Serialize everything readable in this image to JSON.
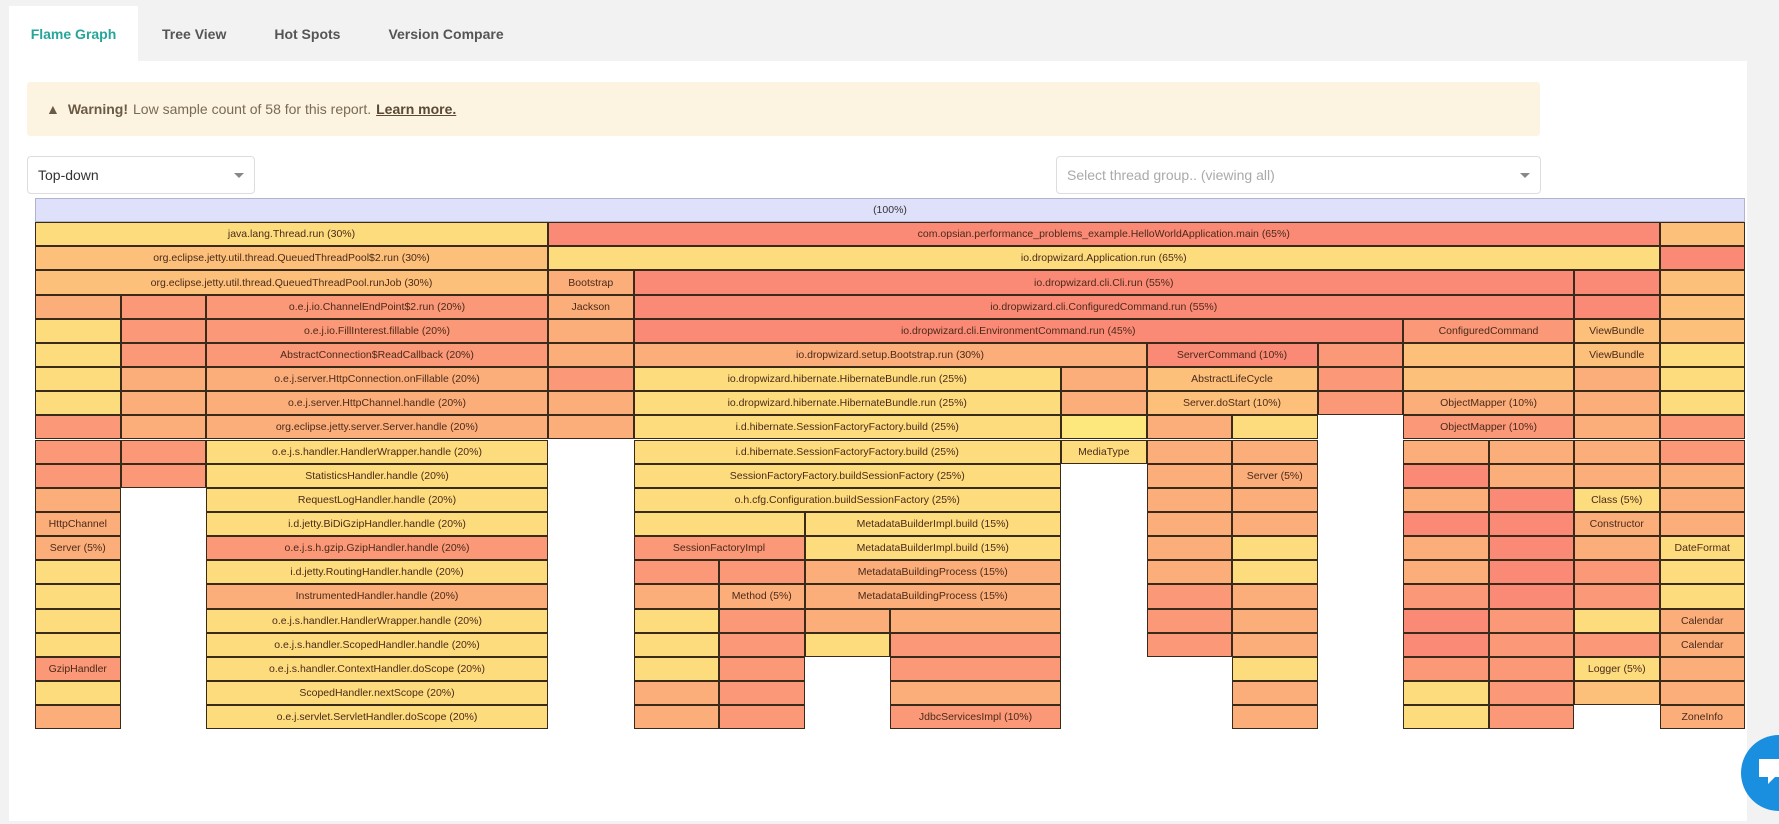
{
  "tabs": [
    {
      "label": "Flame Graph",
      "active": true
    },
    {
      "label": "Tree View",
      "active": false
    },
    {
      "label": "Hot Spots",
      "active": false
    },
    {
      "label": "Version Compare",
      "active": false
    }
  ],
  "warning": {
    "icon": "warning-triangle-icon",
    "title": "Warning!",
    "message": "Low sample count of 58 for this report.",
    "link": "Learn more."
  },
  "direction_select": {
    "value": "Top-down"
  },
  "thread_group_select": {
    "placeholder": "Select thread group.. (viewing all)"
  },
  "colors": {
    "root": "#dfe1fb",
    "yellow": "#fddc7e",
    "light_orange": "#fdc07a",
    "orange": "#fcae7a",
    "salmon": "#fa9878",
    "red": "#fa8a76",
    "bright_yellow": "#fde87e",
    "accent": "#26a69a",
    "chat": "#1a8fe0"
  },
  "flame_graph": {
    "total_units": 20,
    "rows": [
      [
        [
          0,
          20,
          "(100%)",
          "root"
        ]
      ],
      [
        [
          0,
          6,
          "java.lang.Thread.run (30%)",
          "yellow"
        ],
        [
          6,
          13,
          "com.opsian.performance_problems_example.HelloWorldApplication.main (65%)",
          "red"
        ],
        [
          19,
          1,
          "",
          "light_orange"
        ]
      ],
      [
        [
          0,
          6,
          "org.eclipse.jetty.util.thread.QueuedThreadPool$2.run (30%)",
          "light_orange"
        ],
        [
          6,
          13,
          "io.dropwizard.Application.run (65%)",
          "yellow"
        ],
        [
          19,
          1,
          "",
          "red"
        ]
      ],
      [
        [
          0,
          6,
          "org.eclipse.jetty.util.thread.QueuedThreadPool.runJob (30%)",
          "light_orange"
        ],
        [
          6,
          1,
          "Bootstrap",
          "orange"
        ],
        [
          7,
          11,
          "io.dropwizard.cli.Cli.run (55%)",
          "red"
        ],
        [
          18,
          1,
          "",
          "red"
        ],
        [
          19,
          1,
          "",
          "light_orange"
        ]
      ],
      [
        [
          0,
          1,
          "",
          "orange"
        ],
        [
          1,
          1,
          "",
          "salmon"
        ],
        [
          2,
          4,
          "o.e.j.io.ChannelEndPoint$2.run (20%)",
          "salmon"
        ],
        [
          6,
          1,
          "Jackson",
          "orange"
        ],
        [
          7,
          11,
          "io.dropwizard.cli.ConfiguredCommand.run (55%)",
          "red"
        ],
        [
          18,
          1,
          "",
          "red"
        ],
        [
          19,
          1,
          "",
          "light_orange"
        ]
      ],
      [
        [
          0,
          1,
          "",
          "yellow"
        ],
        [
          1,
          1,
          "",
          "salmon"
        ],
        [
          2,
          4,
          "o.e.j.io.FillInterest.fillable (20%)",
          "salmon"
        ],
        [
          6,
          1,
          "",
          "orange"
        ],
        [
          7,
          9,
          "io.dropwizard.cli.EnvironmentCommand.run (45%)",
          "red"
        ],
        [
          16,
          2,
          "ConfiguredCommand",
          "salmon"
        ],
        [
          18,
          1,
          "ViewBundle",
          "light_orange"
        ],
        [
          19,
          1,
          "",
          "light_orange"
        ]
      ],
      [
        [
          0,
          1,
          "",
          "yellow"
        ],
        [
          1,
          1,
          "",
          "salmon"
        ],
        [
          2,
          4,
          "AbstractConnection$ReadCallback (20%)",
          "salmon"
        ],
        [
          6,
          1,
          "",
          "orange"
        ],
        [
          7,
          6,
          "io.dropwizard.setup.Bootstrap.run (30%)",
          "orange"
        ],
        [
          13,
          2,
          "ServerCommand (10%)",
          "red"
        ],
        [
          15,
          1,
          "",
          "salmon"
        ],
        [
          16,
          2,
          "",
          "light_orange"
        ],
        [
          18,
          1,
          "ViewBundle",
          "light_orange"
        ],
        [
          19,
          1,
          "",
          "yellow"
        ]
      ],
      [
        [
          0,
          1,
          "",
          "yellow"
        ],
        [
          1,
          1,
          "",
          "orange"
        ],
        [
          2,
          4,
          "o.e.j.server.HttpConnection.onFillable (20%)",
          "orange"
        ],
        [
          6,
          1,
          "",
          "salmon"
        ],
        [
          7,
          5,
          "io.dropwizard.hibernate.HibernateBundle.run (25%)",
          "yellow"
        ],
        [
          12,
          1,
          "",
          "orange"
        ],
        [
          13,
          2,
          "AbstractLifeCycle",
          "light_orange"
        ],
        [
          15,
          1,
          "",
          "salmon"
        ],
        [
          16,
          2,
          "",
          "light_orange"
        ],
        [
          18,
          1,
          "",
          "orange"
        ],
        [
          19,
          1,
          "",
          "yellow"
        ]
      ],
      [
        [
          0,
          1,
          "",
          "yellow"
        ],
        [
          1,
          1,
          "",
          "orange"
        ],
        [
          2,
          4,
          "o.e.j.server.HttpChannel.handle (20%)",
          "orange"
        ],
        [
          6,
          1,
          "",
          "orange"
        ],
        [
          7,
          5,
          "io.dropwizard.hibernate.HibernateBundle.run (25%)",
          "yellow"
        ],
        [
          12,
          1,
          "",
          "orange"
        ],
        [
          13,
          2,
          "Server.doStart (10%)",
          "light_orange"
        ],
        [
          15,
          1,
          "",
          "salmon"
        ],
        [
          16,
          2,
          "ObjectMapper (10%)",
          "orange"
        ],
        [
          18,
          1,
          "",
          "orange"
        ],
        [
          19,
          1,
          "",
          "yellow"
        ]
      ],
      [
        [
          0,
          1,
          "",
          "salmon"
        ],
        [
          1,
          1,
          "",
          "orange"
        ],
        [
          2,
          4,
          "org.eclipse.jetty.server.Server.handle (20%)",
          "orange"
        ],
        [
          6,
          1,
          "",
          "orange"
        ],
        [
          7,
          5,
          "i.d.hibernate.SessionFactoryFactory.build (25%)",
          "yellow"
        ],
        [
          12,
          1,
          "",
          "bright_yellow"
        ],
        [
          13,
          1,
          "",
          "orange"
        ],
        [
          14,
          1,
          "",
          "yellow"
        ],
        [
          16,
          2,
          "ObjectMapper (10%)",
          "salmon"
        ],
        [
          18,
          1,
          "",
          "orange"
        ],
        [
          19,
          1,
          "",
          "salmon"
        ]
      ],
      [
        [
          0,
          1,
          "",
          "salmon"
        ],
        [
          1,
          1,
          "",
          "salmon"
        ],
        [
          2,
          4,
          "o.e.j.s.handler.HandlerWrapper.handle (20%)",
          "yellow"
        ],
        [
          7,
          5,
          "i.d.hibernate.SessionFactoryFactory.build (25%)",
          "yellow"
        ],
        [
          12,
          1,
          "MediaType",
          "yellow"
        ],
        [
          13,
          1,
          "",
          "orange"
        ],
        [
          14,
          1,
          "",
          "orange"
        ],
        [
          16,
          1,
          "",
          "orange"
        ],
        [
          17,
          1,
          "",
          "orange"
        ],
        [
          18,
          1,
          "",
          "orange"
        ],
        [
          19,
          1,
          "",
          "salmon"
        ]
      ],
      [
        [
          0,
          1,
          "",
          "salmon"
        ],
        [
          1,
          1,
          "",
          "salmon"
        ],
        [
          2,
          4,
          "StatisticsHandler.handle (20%)",
          "yellow"
        ],
        [
          7,
          5,
          "SessionFactoryFactory.buildSessionFactory (25%)",
          "yellow"
        ],
        [
          13,
          1,
          "",
          "orange"
        ],
        [
          14,
          1,
          "Server (5%)",
          "orange"
        ],
        [
          16,
          1,
          "",
          "red"
        ],
        [
          17,
          1,
          "",
          "orange"
        ],
        [
          18,
          1,
          "",
          "orange"
        ],
        [
          19,
          1,
          "",
          "orange"
        ]
      ],
      [
        [
          0,
          1,
          "",
          "orange"
        ],
        [
          2,
          4,
          "RequestLogHandler.handle (20%)",
          "yellow"
        ],
        [
          7,
          5,
          "o.h.cfg.Configuration.buildSessionFactory (25%)",
          "yellow"
        ],
        [
          13,
          1,
          "",
          "orange"
        ],
        [
          14,
          1,
          "",
          "orange"
        ],
        [
          16,
          1,
          "",
          "orange"
        ],
        [
          17,
          1,
          "",
          "red"
        ],
        [
          18,
          1,
          "Class (5%)",
          "yellow"
        ],
        [
          19,
          1,
          "",
          "orange"
        ]
      ],
      [
        [
          0,
          1,
          "HttpChannel",
          "orange"
        ],
        [
          2,
          4,
          "i.d.jetty.BiDiGzipHandler.handle (20%)",
          "yellow"
        ],
        [
          7,
          2,
          "",
          "yellow"
        ],
        [
          9,
          3,
          "MetadataBuilderImpl.build (15%)",
          "yellow"
        ],
        [
          13,
          1,
          "",
          "orange"
        ],
        [
          14,
          1,
          "",
          "orange"
        ],
        [
          16,
          1,
          "",
          "red"
        ],
        [
          17,
          1,
          "",
          "red"
        ],
        [
          18,
          1,
          "Constructor",
          "orange"
        ],
        [
          19,
          1,
          "",
          "orange"
        ]
      ],
      [
        [
          0,
          1,
          "Server (5%)",
          "orange"
        ],
        [
          2,
          4,
          "o.e.j.s.h.gzip.GzipHandler.handle (20%)",
          "salmon"
        ],
        [
          7,
          2,
          "SessionFactoryImpl",
          "salmon"
        ],
        [
          9,
          3,
          "MetadataBuilderImpl.build (15%)",
          "yellow"
        ],
        [
          13,
          1,
          "",
          "orange"
        ],
        [
          14,
          1,
          "",
          "yellow"
        ],
        [
          16,
          1,
          "",
          "orange"
        ],
        [
          17,
          1,
          "",
          "red"
        ],
        [
          18,
          1,
          "",
          "orange"
        ],
        [
          19,
          1,
          "DateFormat",
          "yellow"
        ]
      ],
      [
        [
          0,
          1,
          "",
          "yellow"
        ],
        [
          2,
          4,
          "i.d.jetty.RoutingHandler.handle (20%)",
          "yellow"
        ],
        [
          7,
          1,
          "",
          "salmon"
        ],
        [
          8,
          1,
          "",
          "salmon"
        ],
        [
          9,
          3,
          "MetadataBuildingProcess (15%)",
          "orange"
        ],
        [
          13,
          1,
          "",
          "orange"
        ],
        [
          14,
          1,
          "",
          "yellow"
        ],
        [
          16,
          1,
          "",
          "orange"
        ],
        [
          17,
          1,
          "",
          "red"
        ],
        [
          18,
          1,
          "",
          "salmon"
        ],
        [
          19,
          1,
          "",
          "yellow"
        ]
      ],
      [
        [
          0,
          1,
          "",
          "yellow"
        ],
        [
          2,
          4,
          "InstrumentedHandler.handle (20%)",
          "orange"
        ],
        [
          7,
          1,
          "",
          "orange"
        ],
        [
          8,
          1,
          "Method (5%)",
          "orange"
        ],
        [
          9,
          3,
          "MetadataBuildingProcess (15%)",
          "orange"
        ],
        [
          13,
          1,
          "",
          "salmon"
        ],
        [
          14,
          1,
          "",
          "orange"
        ],
        [
          16,
          1,
          "",
          "salmon"
        ],
        [
          17,
          1,
          "",
          "red"
        ],
        [
          18,
          1,
          "",
          "salmon"
        ],
        [
          19,
          1,
          "",
          "yellow"
        ]
      ],
      [
        [
          0,
          1,
          "",
          "yellow"
        ],
        [
          2,
          4,
          "o.e.j.s.handler.HandlerWrapper.handle (20%)",
          "yellow"
        ],
        [
          7,
          1,
          "",
          "yellow"
        ],
        [
          8,
          1,
          "",
          "salmon"
        ],
        [
          9,
          1,
          "",
          "orange"
        ],
        [
          10,
          2,
          "",
          "orange"
        ],
        [
          13,
          1,
          "",
          "salmon"
        ],
        [
          14,
          1,
          "",
          "orange"
        ],
        [
          16,
          1,
          "",
          "red"
        ],
        [
          17,
          1,
          "",
          "salmon"
        ],
        [
          18,
          1,
          "",
          "yellow"
        ],
        [
          19,
          1,
          "Calendar",
          "orange"
        ]
      ],
      [
        [
          0,
          1,
          "",
          "yellow"
        ],
        [
          2,
          4,
          "o.e.j.s.handler.ScopedHandler.handle (20%)",
          "yellow"
        ],
        [
          7,
          1,
          "",
          "yellow"
        ],
        [
          8,
          1,
          "",
          "salmon"
        ],
        [
          9,
          1,
          "",
          "yellow"
        ],
        [
          10,
          2,
          "",
          "salmon"
        ],
        [
          13,
          1,
          "",
          "salmon"
        ],
        [
          14,
          1,
          "",
          "orange"
        ],
        [
          16,
          1,
          "",
          "red"
        ],
        [
          17,
          1,
          "",
          "salmon"
        ],
        [
          18,
          1,
          "",
          "salmon"
        ],
        [
          19,
          1,
          "Calendar",
          "orange"
        ]
      ],
      [
        [
          0,
          1,
          "GzipHandler",
          "salmon"
        ],
        [
          2,
          4,
          "o.e.j.s.handler.ContextHandler.doScope (20%)",
          "yellow"
        ],
        [
          7,
          1,
          "",
          "yellow"
        ],
        [
          8,
          1,
          "",
          "salmon"
        ],
        [
          10,
          2,
          "",
          "salmon"
        ],
        [
          14,
          1,
          "",
          "yellow"
        ],
        [
          16,
          1,
          "",
          "salmon"
        ],
        [
          17,
          1,
          "",
          "salmon"
        ],
        [
          18,
          1,
          "Logger (5%)",
          "yellow"
        ],
        [
          19,
          1,
          "",
          "orange"
        ]
      ],
      [
        [
          0,
          1,
          "",
          "yellow"
        ],
        [
          2,
          4,
          "ScopedHandler.nextScope (20%)",
          "yellow"
        ],
        [
          7,
          1,
          "",
          "orange"
        ],
        [
          8,
          1,
          "",
          "salmon"
        ],
        [
          10,
          2,
          "",
          "orange"
        ],
        [
          14,
          1,
          "",
          "orange"
        ],
        [
          16,
          1,
          "",
          "yellow"
        ],
        [
          17,
          1,
          "",
          "salmon"
        ],
        [
          18,
          1,
          "",
          "light_orange"
        ],
        [
          19,
          1,
          "",
          "orange"
        ]
      ],
      [
        [
          0,
          1,
          "",
          "orange"
        ],
        [
          2,
          4,
          "o.e.j.servlet.ServletHandler.doScope (20%)",
          "yellow"
        ],
        [
          7,
          1,
          "",
          "orange"
        ],
        [
          8,
          1,
          "",
          "salmon"
        ],
        [
          10,
          2,
          "JdbcServicesImpl (10%)",
          "salmon"
        ],
        [
          14,
          1,
          "",
          "orange"
        ],
        [
          16,
          1,
          "",
          "yellow"
        ],
        [
          17,
          1,
          "",
          "salmon"
        ],
        [
          19,
          1,
          "ZoneInfo",
          "orange"
        ]
      ]
    ]
  },
  "chat_button": {
    "icon": "chat-bubble-icon"
  }
}
